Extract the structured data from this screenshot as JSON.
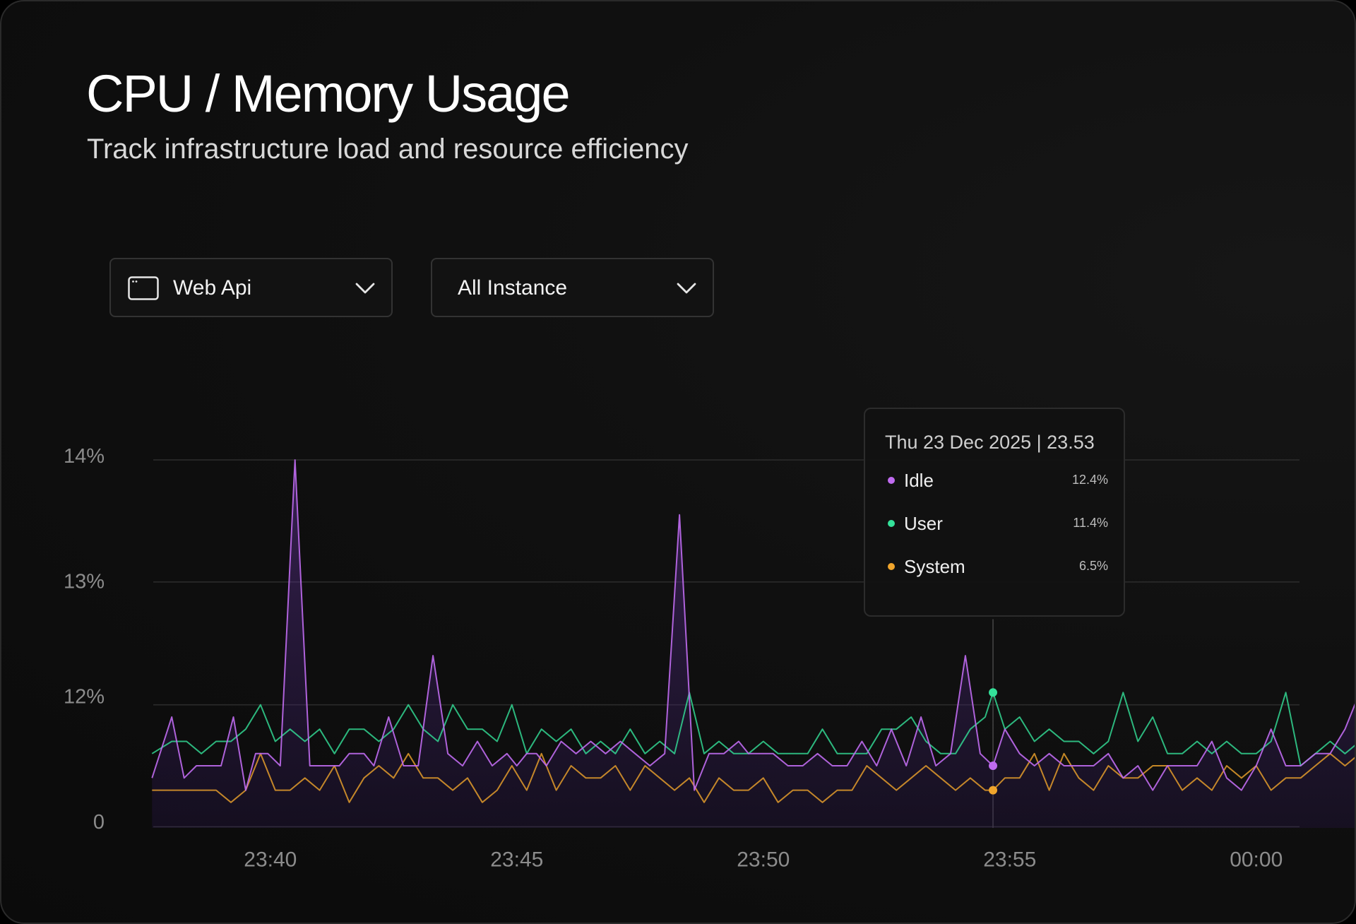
{
  "header": {
    "title": "CPU / Memory Usage",
    "subtitle": "Track infrastructure load and resource efficiency"
  },
  "filters": {
    "service": {
      "label": "Web Api",
      "icon": "window-icon"
    },
    "instance": {
      "label": "All Instance"
    }
  },
  "tooltip": {
    "date": "Thu 23 Dec 2025 | 23.53",
    "items": [
      {
        "name": "Idle",
        "value": "12.4%",
        "color": "#c06bf0"
      },
      {
        "name": "User",
        "value": "11.4%",
        "color": "#34e29a"
      },
      {
        "name": "System",
        "value": "6.5%",
        "color": "#f0a52c"
      }
    ]
  },
  "colors": {
    "idle": "#c06bf0",
    "user": "#34e29a",
    "system": "#f0a52c",
    "grid": "#2b2b2b",
    "background": "#101010"
  },
  "chart_data": {
    "type": "line",
    "x_ticks": [
      "23:40",
      "23:45",
      "23:50",
      "23:55",
      "00:00"
    ],
    "y_ticks": [
      "0",
      "12%",
      "13%",
      "14%"
    ],
    "y_tick_values": [
      11,
      12,
      13,
      14
    ],
    "ylim": [
      11,
      14
    ],
    "xlim": [
      37.6,
      62.5
    ],
    "grid": "horizontal",
    "legend": "tooltip",
    "hover_x": 54.66,
    "series": [
      {
        "name": "Idle",
        "color": "#c06bf0",
        "x": [
          37.6,
          38.0,
          38.25,
          38.5,
          38.75,
          39.0,
          39.25,
          39.5,
          39.7,
          39.95,
          40.2,
          40.5,
          40.8,
          41.1,
          41.4,
          41.6,
          41.9,
          42.1,
          42.4,
          42.7,
          43.0,
          43.3,
          43.6,
          43.9,
          44.2,
          44.5,
          44.8,
          45.0,
          45.2,
          45.4,
          45.6,
          45.9,
          46.2,
          46.5,
          46.8,
          47.1,
          47.4,
          47.7,
          48.0,
          48.3,
          48.6,
          48.9,
          49.2,
          49.5,
          49.7,
          49.95,
          50.2,
          50.5,
          50.8,
          51.1,
          51.4,
          51.7,
          52.0,
          52.3,
          52.6,
          52.9,
          53.2,
          53.5,
          53.8,
          54.1,
          54.4,
          54.66,
          54.9,
          55.2,
          55.5,
          55.8,
          56.1,
          56.4,
          56.7,
          57.0,
          57.3,
          57.6,
          57.9,
          58.2,
          58.5,
          58.8,
          59.1,
          59.4,
          59.7,
          60.0,
          60.3,
          60.6,
          60.9,
          61.2,
          61.5,
          61.8,
          62.1,
          62.5
        ],
        "values": [
          11.4,
          11.9,
          11.4,
          11.5,
          11.5,
          11.5,
          11.9,
          11.3,
          11.6,
          11.6,
          11.5,
          14.0,
          11.5,
          11.5,
          11.5,
          11.6,
          11.6,
          11.5,
          11.9,
          11.5,
          11.5,
          12.4,
          11.6,
          11.5,
          11.7,
          11.5,
          11.6,
          11.5,
          11.6,
          11.6,
          11.5,
          11.7,
          11.6,
          11.7,
          11.6,
          11.7,
          11.6,
          11.5,
          11.6,
          13.55,
          11.3,
          11.6,
          11.6,
          11.7,
          11.6,
          11.6,
          11.6,
          11.5,
          11.5,
          11.6,
          11.5,
          11.5,
          11.7,
          11.5,
          11.8,
          11.5,
          11.9,
          11.5,
          11.6,
          12.4,
          11.6,
          11.5,
          11.8,
          11.6,
          11.5,
          11.6,
          11.5,
          11.5,
          11.5,
          11.6,
          11.4,
          11.5,
          11.3,
          11.5,
          11.5,
          11.5,
          11.7,
          11.4,
          11.3,
          11.5,
          11.8,
          11.5,
          11.5,
          11.6,
          11.6,
          11.8,
          12.1,
          11.4
        ]
      },
      {
        "name": "User",
        "color": "#34e29a",
        "x": [
          37.6,
          38.0,
          38.3,
          38.6,
          38.9,
          39.2,
          39.5,
          39.8,
          40.1,
          40.4,
          40.7,
          41.0,
          41.3,
          41.6,
          41.9,
          42.2,
          42.5,
          42.8,
          43.1,
          43.4,
          43.7,
          44.0,
          44.3,
          44.6,
          44.9,
          45.2,
          45.5,
          45.8,
          46.1,
          46.4,
          46.7,
          47.0,
          47.3,
          47.6,
          47.9,
          48.2,
          48.5,
          48.8,
          49.1,
          49.4,
          49.7,
          50.0,
          50.3,
          50.6,
          50.9,
          51.2,
          51.5,
          51.8,
          52.1,
          52.4,
          52.7,
          53.0,
          53.3,
          53.6,
          53.9,
          54.2,
          54.5,
          54.66,
          54.9,
          55.2,
          55.5,
          55.8,
          56.1,
          56.4,
          56.7,
          57.0,
          57.3,
          57.6,
          57.9,
          58.2,
          58.5,
          58.8,
          59.1,
          59.4,
          59.7,
          60.0,
          60.3,
          60.6,
          60.9,
          61.2,
          61.5,
          61.8,
          62.1,
          62.5
        ],
        "values": [
          11.6,
          11.7,
          11.7,
          11.6,
          11.7,
          11.7,
          11.8,
          12.0,
          11.7,
          11.8,
          11.7,
          11.8,
          11.6,
          11.8,
          11.8,
          11.7,
          11.8,
          12.0,
          11.8,
          11.7,
          12.0,
          11.8,
          11.8,
          11.7,
          12.0,
          11.6,
          11.8,
          11.7,
          11.8,
          11.6,
          11.7,
          11.6,
          11.8,
          11.6,
          11.7,
          11.6,
          12.1,
          11.6,
          11.7,
          11.6,
          11.6,
          11.7,
          11.6,
          11.6,
          11.6,
          11.8,
          11.6,
          11.6,
          11.6,
          11.8,
          11.8,
          11.9,
          11.7,
          11.6,
          11.6,
          11.8,
          11.9,
          12.1,
          11.8,
          11.9,
          11.7,
          11.8,
          11.7,
          11.7,
          11.6,
          11.7,
          12.1,
          11.7,
          11.9,
          11.6,
          11.6,
          11.7,
          11.6,
          11.7,
          11.6,
          11.6,
          11.7,
          12.1,
          11.5,
          11.6,
          11.7,
          11.6,
          11.7,
          11.7
        ]
      },
      {
        "name": "System",
        "color": "#f0a52c",
        "x": [
          37.6,
          38.0,
          38.3,
          38.6,
          38.9,
          39.2,
          39.5,
          39.8,
          40.1,
          40.4,
          40.7,
          41.0,
          41.3,
          41.6,
          41.9,
          42.2,
          42.5,
          42.8,
          43.1,
          43.4,
          43.7,
          44.0,
          44.3,
          44.6,
          44.9,
          45.2,
          45.5,
          45.8,
          46.1,
          46.4,
          46.7,
          47.0,
          47.3,
          47.6,
          47.9,
          48.2,
          48.5,
          48.8,
          49.1,
          49.4,
          49.7,
          50.0,
          50.3,
          50.6,
          50.9,
          51.2,
          51.5,
          51.8,
          52.1,
          52.4,
          52.7,
          53.0,
          53.3,
          53.6,
          53.9,
          54.2,
          54.5,
          54.66,
          54.9,
          55.2,
          55.5,
          55.8,
          56.1,
          56.4,
          56.7,
          57.0,
          57.3,
          57.6,
          57.9,
          58.2,
          58.5,
          58.8,
          59.1,
          59.4,
          59.7,
          60.0,
          60.3,
          60.6,
          60.9,
          61.2,
          61.5,
          61.8,
          62.1,
          62.5
        ],
        "values": [
          11.3,
          11.3,
          11.3,
          11.3,
          11.3,
          11.2,
          11.3,
          11.6,
          11.3,
          11.3,
          11.4,
          11.3,
          11.5,
          11.2,
          11.4,
          11.5,
          11.4,
          11.6,
          11.4,
          11.4,
          11.3,
          11.4,
          11.2,
          11.3,
          11.5,
          11.3,
          11.6,
          11.3,
          11.5,
          11.4,
          11.4,
          11.5,
          11.3,
          11.5,
          11.4,
          11.3,
          11.4,
          11.2,
          11.4,
          11.3,
          11.3,
          11.4,
          11.2,
          11.3,
          11.3,
          11.2,
          11.3,
          11.3,
          11.5,
          11.4,
          11.3,
          11.4,
          11.5,
          11.4,
          11.3,
          11.4,
          11.3,
          11.3,
          11.4,
          11.4,
          11.6,
          11.3,
          11.6,
          11.4,
          11.3,
          11.5,
          11.4,
          11.4,
          11.5,
          11.5,
          11.3,
          11.4,
          11.3,
          11.5,
          11.4,
          11.5,
          11.3,
          11.4,
          11.4,
          11.5,
          11.6,
          11.5,
          11.6,
          11.4
        ]
      }
    ]
  }
}
